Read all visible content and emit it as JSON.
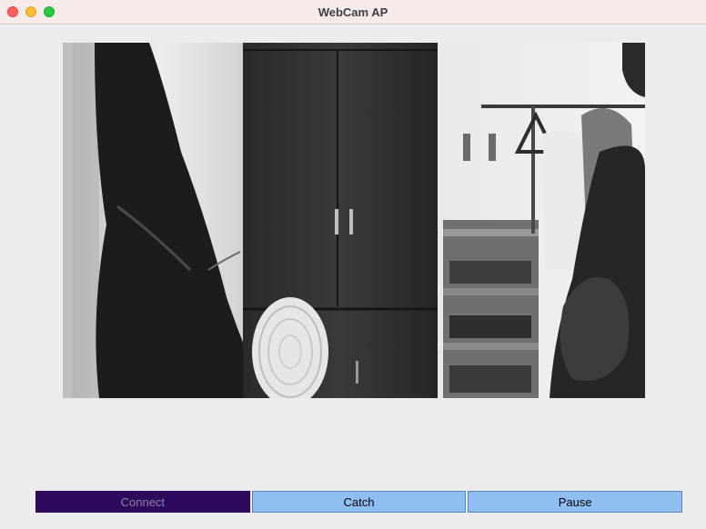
{
  "window": {
    "title": "WebCam AP"
  },
  "controls": {
    "connect_label": "Connect",
    "catch_label": "Catch",
    "pause_label": "Pause"
  },
  "colors": {
    "connect_bg": "#2e0a5e",
    "button_bg": "#8fbff2",
    "titlebar_bg": "#f6eaea"
  }
}
